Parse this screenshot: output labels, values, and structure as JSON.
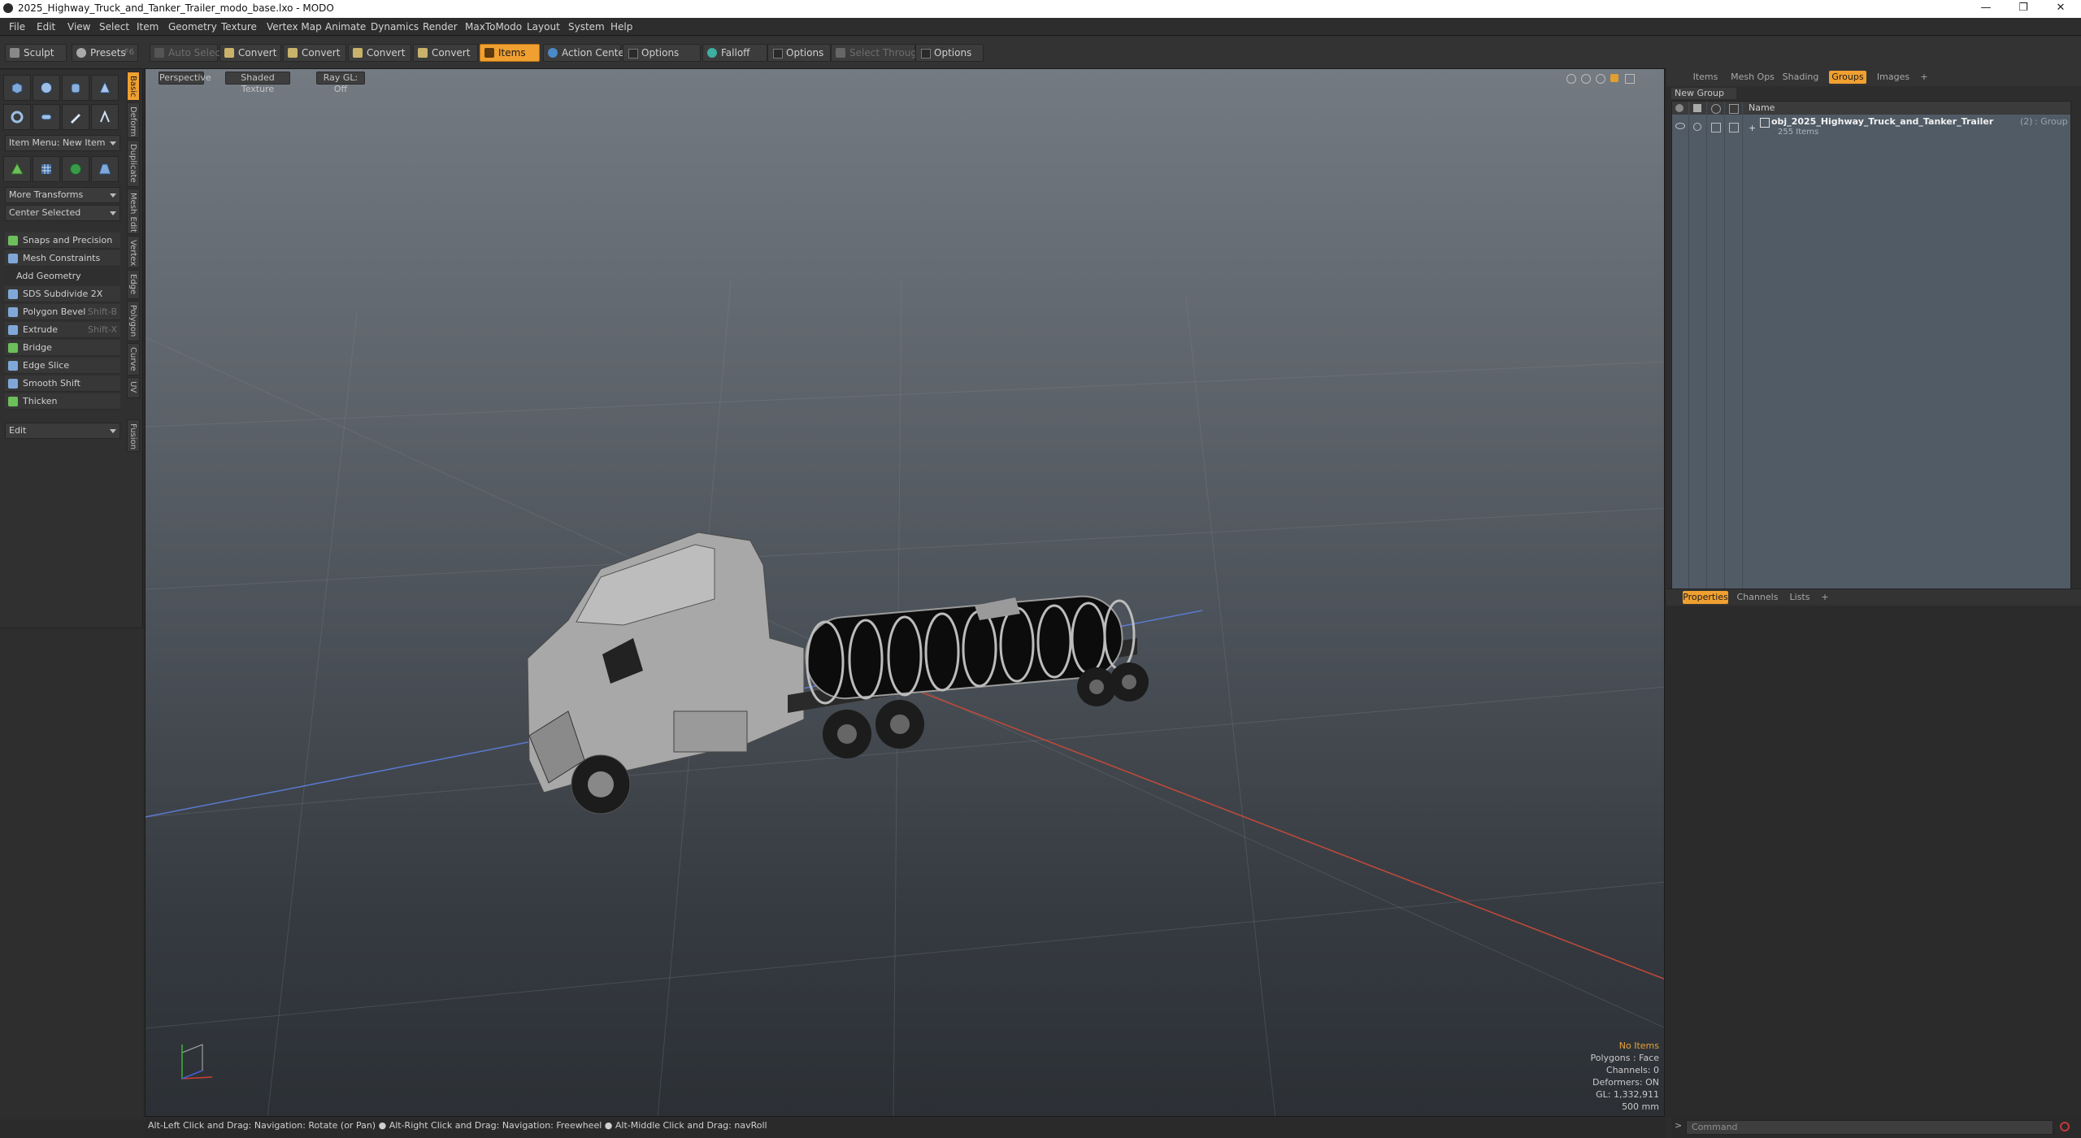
{
  "window": {
    "title": "2025_Highway_Truck_and_Tanker_Trailer_modo_base.lxo - MODO",
    "minimize": "—",
    "maximize": "❐",
    "close": "✕"
  },
  "menu": [
    "File",
    "Edit",
    "View",
    "Select",
    "Item",
    "Geometry",
    "Texture",
    "Vertex Map",
    "Animate",
    "Dynamics",
    "Render",
    "MaxToModo",
    "Layout",
    "System",
    "Help"
  ],
  "toolbar": {
    "sculpt": "Sculpt",
    "presets": "Presets",
    "presets_key": "F6",
    "auto_select": "Auto Select",
    "convert1": "Convert",
    "convert2": "Convert",
    "convert3": "Convert",
    "convert4": "Convert",
    "items": "Items",
    "action_center": "Action Center",
    "options1": "Options",
    "falloff": "Falloff",
    "options2": "Options",
    "select_through": "Select Through",
    "options3": "Options"
  },
  "left_panel": {
    "item_menu": "Item Menu: New Item",
    "more_transforms": "More Transforms",
    "center_selected": "Center Selected",
    "snaps": "Snaps and Precision",
    "mesh_constraints": "Mesh Constraints",
    "add_geometry": "Add Geometry",
    "tools": [
      {
        "label": "SDS Subdivide 2X",
        "shortcut": ""
      },
      {
        "label": "Polygon Bevel",
        "shortcut": "Shift-B"
      },
      {
        "label": "Extrude",
        "shortcut": "Shift-X"
      },
      {
        "label": "Bridge",
        "shortcut": ""
      },
      {
        "label": "Edge Slice",
        "shortcut": ""
      },
      {
        "label": "Smooth Shift",
        "shortcut": ""
      },
      {
        "label": "Thicken",
        "shortcut": ""
      }
    ],
    "edit": "Edit",
    "vertical_tabs": [
      "Basic",
      "Deform",
      "Duplicate",
      "Mesh Edit",
      "Vertex",
      "Edge",
      "Polygon",
      "Curve",
      "UV",
      "Fusion"
    ]
  },
  "viewport": {
    "view_mode": "Perspective",
    "shading": "Shaded Texture",
    "ray_gl": "Ray GL: Off",
    "info": {
      "selection": "No Items",
      "polygons": "Polygons : Face",
      "channels": "Channels: 0",
      "deformers": "Deformers: ON",
      "gl": "GL: 1,332,911",
      "scale": "500 mm"
    }
  },
  "status_bar": "Alt-Left Click and Drag: Navigation: Rotate (or Pan) ●  Alt-Right Click and Drag: Navigation: Freewheel ●  Alt-Middle Click and Drag: navRoll",
  "right_panel": {
    "tabs": [
      "Items",
      "Mesh Ops",
      "Shading",
      "Groups",
      "Images"
    ],
    "active_tab": "Groups",
    "new_group": "New Group",
    "column_name": "Name",
    "group": {
      "name": "obj_2025_Highway_Truck_and_Tanker_Trailer",
      "count": "(2)",
      "type": ": Group",
      "items": "255 Items"
    },
    "prop_tabs": [
      "Properties",
      "Channels",
      "Lists"
    ],
    "active_prop_tab": "Properties",
    "command_placeholder": "Command"
  },
  "colors": {
    "accent": "#f0a030",
    "viewport_top": "#747a82",
    "viewport_bottom": "#2c3035"
  }
}
